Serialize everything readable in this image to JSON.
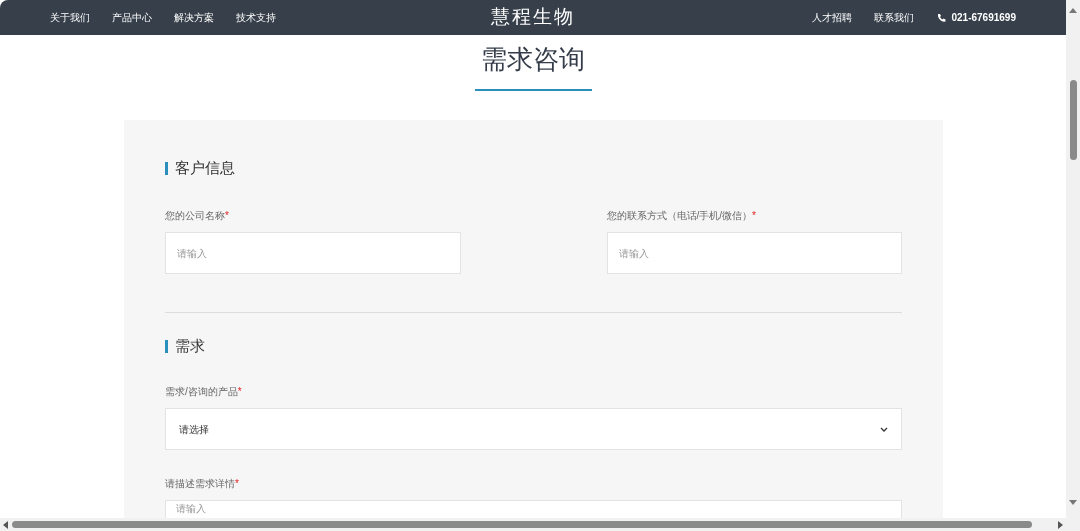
{
  "nav": {
    "left_links": [
      "关于我们",
      "产品中心",
      "解决方案",
      "技术支持"
    ],
    "logo": "慧程生物",
    "right_links": [
      "人才招聘",
      "联系我们"
    ],
    "phone": "021-67691699"
  },
  "page_title": "需求咨询",
  "sections": [
    {
      "title": "客户信息",
      "kind": "pair",
      "fields": [
        {
          "label": "您的公司名称",
          "required_mark": "*",
          "kind": "input",
          "placeholder": "请输入"
        },
        {
          "label": "您的联系方式（电话/手机/微信）",
          "required_mark": "*",
          "kind": "input",
          "placeholder": "请输入"
        }
      ]
    },
    {
      "title": "需求",
      "kind": "stack",
      "fields": [
        {
          "label": "需求/咨询的产品",
          "required_mark": "*",
          "kind": "select",
          "value": "请选择"
        },
        {
          "label": "请描述需求详情",
          "required_mark": "*",
          "kind": "textarea",
          "placeholder": "请输入"
        }
      ]
    }
  ]
}
